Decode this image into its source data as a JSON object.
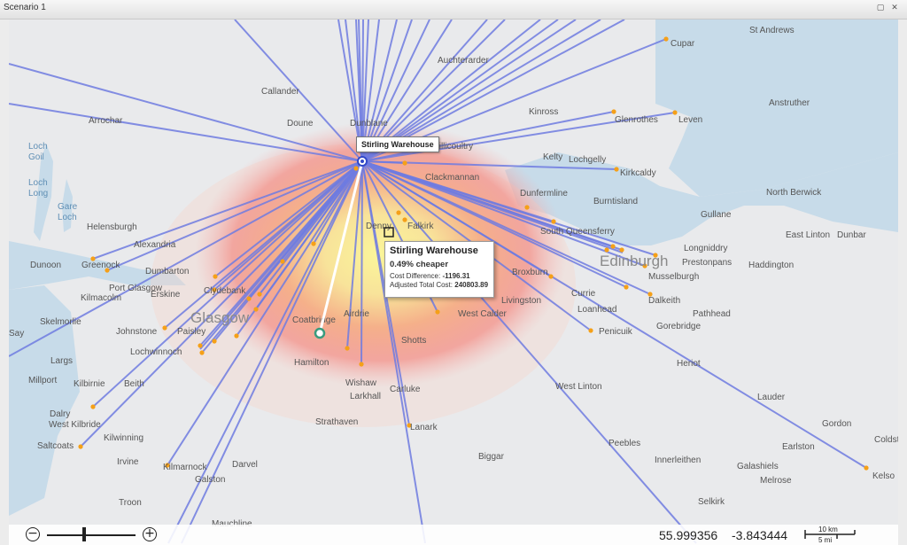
{
  "window": {
    "title": "Scenario 1",
    "restore_icon": "▢",
    "close_icon": "✕"
  },
  "warehouse": {
    "label": "Stirling Warehouse"
  },
  "tooltip": {
    "title": "Stirling Warehouse",
    "subtitle": "0.49% cheaper",
    "cost_difference_label": "Cost Difference:",
    "cost_difference_value": "-1196.31",
    "adjusted_total_cost_label": "Adjusted Total Cost:",
    "adjusted_total_cost_value": "240803.89"
  },
  "zoom": {
    "minus": "−",
    "plus": "+",
    "level": 0.42
  },
  "coordinates": {
    "latitude": "55.999356",
    "longitude": "-3.843444"
  },
  "scale_bar": {
    "km": "10 km",
    "mi": "5 mi"
  },
  "places": [
    "St Andrews",
    "Cupar",
    "Auchterarder",
    "Callander",
    "Kinross",
    "Anstruther",
    "Arrochar",
    "Doune",
    "Dunblane",
    "Glenrothes",
    "Leven",
    "Tillicoultry",
    "Kelty",
    "Lochgelly",
    "Clackmannan",
    "Kirkcaldy",
    "Dunfermline",
    "Burntisland",
    "North Berwick",
    "Helensburgh",
    "Gullane",
    "Denny",
    "Falkirk",
    "South Queensferry",
    "East Linton",
    "Dunbar",
    "Alexandria",
    "Linlithgow",
    "Longniddry",
    "Dunoon",
    "Greenock",
    "Dumbarton",
    "Edinburgh",
    "Prestonpans",
    "Haddington",
    "Port Glasgow",
    "Broxburn",
    "Musselburgh",
    "Clydebank",
    "Erskine",
    "Kilmacolm",
    "Livingston",
    "Currie",
    "Dalkeith",
    "Glasgow",
    "Coatbridge",
    "Airdrie",
    "Loanhead",
    "Pathhead",
    "West Calder",
    "Skelmorlie",
    "Johnstone",
    "Paisley",
    "Gorebridge",
    "Penicuik",
    "Lochwinnoch",
    "Hamilton",
    "Shotts",
    "Largs",
    "Heriot",
    "Millport",
    "Kilbirnie",
    "Beith",
    "Wishaw",
    "Larkhall",
    "Carluke",
    "West Linton",
    "Lauder",
    "Dalry",
    "West Kilbride",
    "Strathaven",
    "Lanark",
    "Gordon",
    "Saltcoats",
    "Kilwinning",
    "Coldstream",
    "Peebles",
    "Earlston",
    "Irvine",
    "Biggar",
    "Innerleithen",
    "Galashiels",
    "Kilmarnock",
    "Darvel",
    "Melrose",
    "Kelso",
    "Galston",
    "Troon",
    "Selkirk",
    "Mauchline",
    "Say"
  ],
  "water_labels": [
    "Loch Goil",
    "Loch Long",
    "Gare Loch"
  ]
}
